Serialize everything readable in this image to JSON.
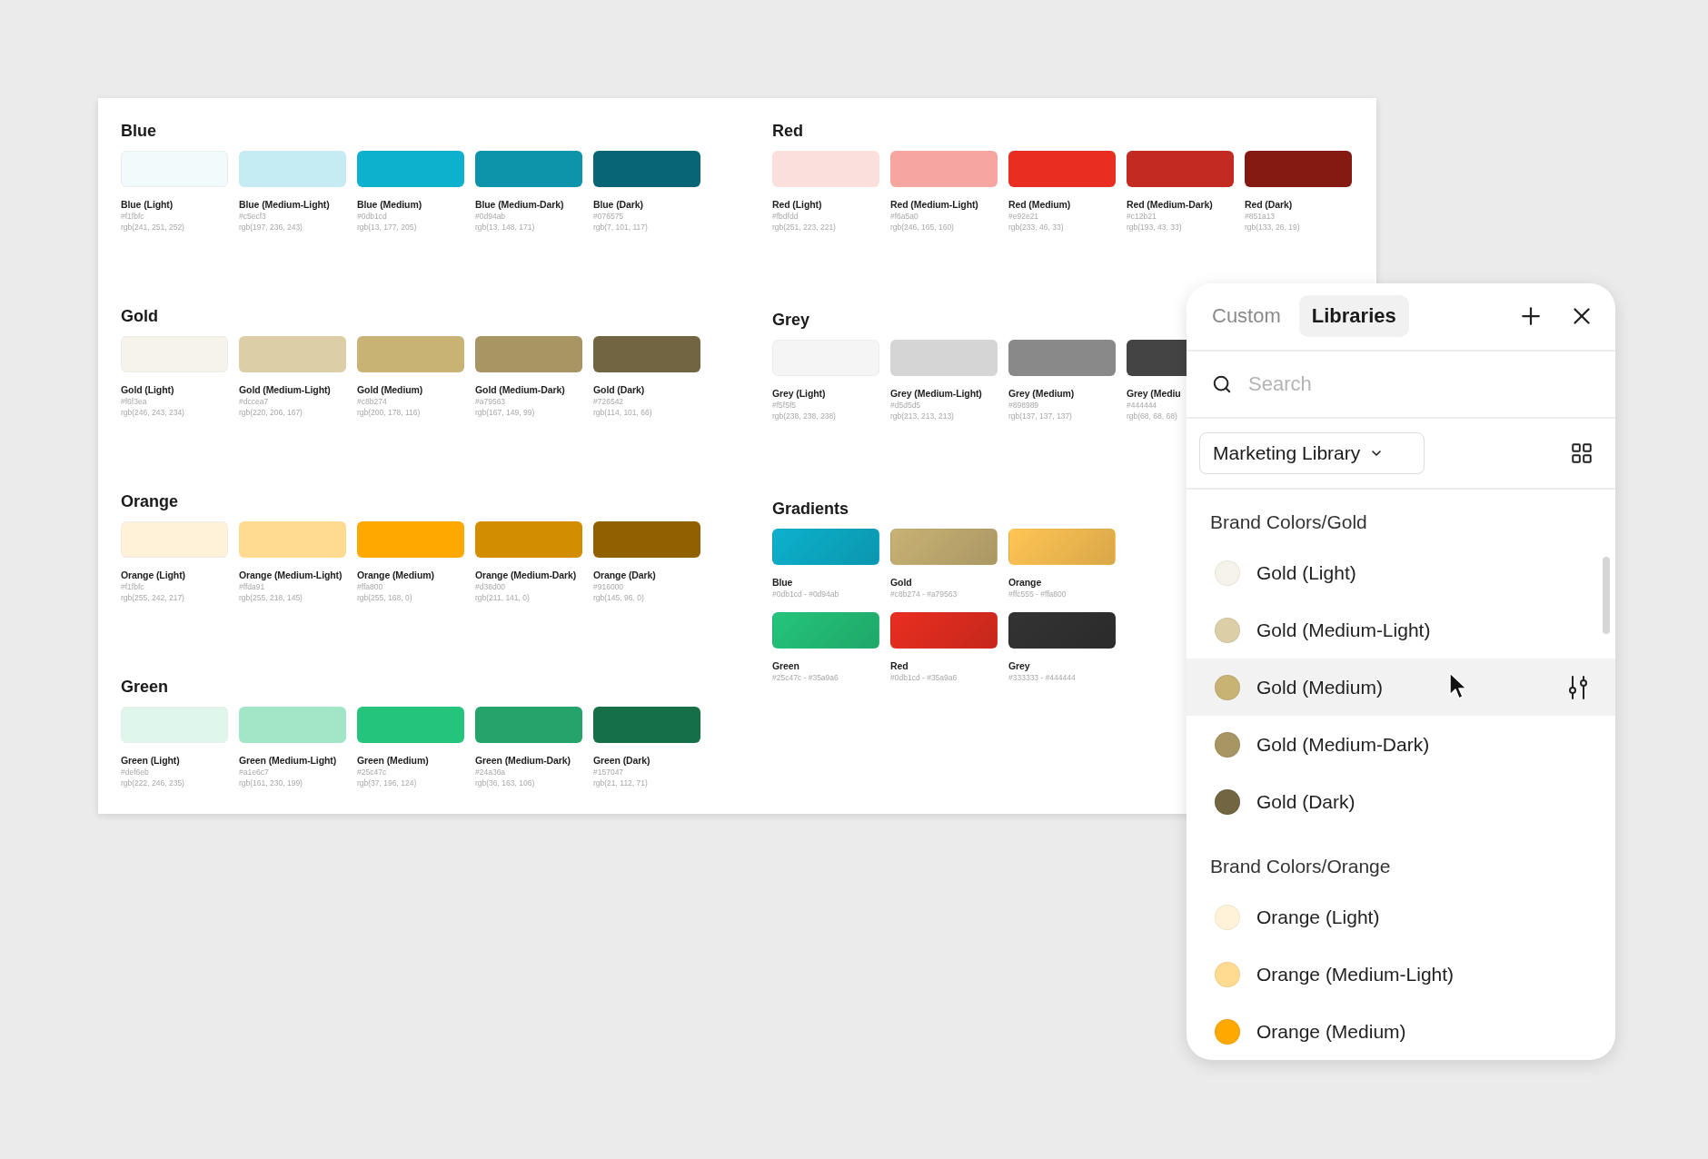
{
  "sheet": {
    "columns": [
      {
        "sections": [
          {
            "title": "Blue",
            "kind": "solid",
            "swatches": [
              {
                "name": "Blue (Light)",
                "hex": "#f1fbfc",
                "rgb": "rgb(241, 251, 252)",
                "color": "#f1fbfc"
              },
              {
                "name": "Blue (Medium-Light)",
                "hex": "#c5ecf3",
                "rgb": "rgb(197, 236, 243)",
                "color": "#c5ecf3"
              },
              {
                "name": "Blue (Medium)",
                "hex": "#0db1cd",
                "rgb": "rgb(13, 177, 205)",
                "color": "#0db1cd"
              },
              {
                "name": "Blue (Medium-Dark)",
                "hex": "#0d94ab",
                "rgb": "rgb(13, 148, 171)",
                "color": "#0d94ab"
              },
              {
                "name": "Blue (Dark)",
                "hex": "#076575",
                "rgb": "rgb(7, 101, 117)",
                "color": "#076575"
              }
            ]
          },
          {
            "title": "Gold",
            "kind": "solid",
            "swatches": [
              {
                "name": "Gold (Light)",
                "hex": "#f6f3ea",
                "rgb": "rgb(246, 243, 234)",
                "color": "#f6f3ea"
              },
              {
                "name": "Gold (Medium-Light)",
                "hex": "#dccea7",
                "rgb": "rgb(220, 206, 167)",
                "color": "#dccea7"
              },
              {
                "name": "Gold (Medium)",
                "hex": "#c8b274",
                "rgb": "rgb(200, 178, 116)",
                "color": "#c8b274"
              },
              {
                "name": "Gold (Medium-Dark)",
                "hex": "#a79563",
                "rgb": "rgb(167, 149, 99)",
                "color": "#a79563"
              },
              {
                "name": "Gold (Dark)",
                "hex": "#726542",
                "rgb": "rgb(114, 101, 66)",
                "color": "#726542"
              }
            ]
          },
          {
            "title": "Orange",
            "kind": "solid",
            "swatches": [
              {
                "name": "Orange (Light)",
                "hex": "#f1fbfc",
                "rgb": "rgb(255, 242, 217)",
                "color": "#fff2d9"
              },
              {
                "name": "Orange (Medium-Light)",
                "hex": "#ffda91",
                "rgb": "rgb(255, 218, 145)",
                "color": "#ffda91"
              },
              {
                "name": "Orange (Medium)",
                "hex": "#ffa800",
                "rgb": "rgb(255, 168, 0)",
                "color": "#ffa800"
              },
              {
                "name": "Orange (Medium-Dark)",
                "hex": "#d38d00",
                "rgb": "rgb(211, 141, 0)",
                "color": "#d38d00"
              },
              {
                "name": "Orange (Dark)",
                "hex": "#916000",
                "rgb": "rgb(145, 96, 0)",
                "color": "#916000"
              }
            ]
          },
          {
            "title": "Green",
            "kind": "solid",
            "swatches": [
              {
                "name": "Green (Light)",
                "hex": "#def6eb",
                "rgb": "rgb(222, 246, 235)",
                "color": "#def6eb"
              },
              {
                "name": "Green (Medium-Light)",
                "hex": "#a1e6c7",
                "rgb": "rgb(161, 230, 199)",
                "color": "#a1e6c7"
              },
              {
                "name": "Green (Medium)",
                "hex": "#25c47c",
                "rgb": "rgb(37, 196, 124)",
                "color": "#25c47c"
              },
              {
                "name": "Green (Medium-Dark)",
                "hex": "#24a36a",
                "rgb": "rgb(36, 163, 106)",
                "color": "#24a36a"
              },
              {
                "name": "Green (Dark)",
                "hex": "#157047",
                "rgb": "rgb(21, 112, 71)",
                "color": "#157047"
              }
            ]
          }
        ]
      },
      {
        "sections": [
          {
            "title": "Red",
            "kind": "solid",
            "swatches": [
              {
                "name": "Red (Light)",
                "hex": "#fbdfdd",
                "rgb": "rgb(251, 223, 221)",
                "color": "#fbdfdd"
              },
              {
                "name": "Red (Medium-Light)",
                "hex": "#f6a5a0",
                "rgb": "rgb(246, 165, 160)",
                "color": "#f6a5a0"
              },
              {
                "name": "Red (Medium)",
                "hex": "#e92e21",
                "rgb": "rgb(233, 46, 33)",
                "color": "#e92e21"
              },
              {
                "name": "Red (Medium-Dark)",
                "hex": "#c12b21",
                "rgb": "rgb(193, 43, 33)",
                "color": "#c12b21"
              },
              {
                "name": "Red (Dark)",
                "hex": "#851a13",
                "rgb": "rgb(133, 26, 19)",
                "color": "#851a13"
              }
            ]
          },
          {
            "title": "Grey",
            "kind": "solid",
            "swatches": [
              {
                "name": "Grey (Light)",
                "hex": "#f5f5f5",
                "rgb": "rgb(238, 238, 238)",
                "color": "#f5f5f5"
              },
              {
                "name": "Grey (Medium-Light)",
                "hex": "#d5d5d5",
                "rgb": "rgb(213, 213, 213)",
                "color": "#d5d5d5"
              },
              {
                "name": "Grey (Medium)",
                "hex": "#898989",
                "rgb": "rgb(137, 137, 137)",
                "color": "#898989"
              },
              {
                "name": "Grey (Mediu",
                "hex": "#444444",
                "rgb": "rgb(68, 68, 68)",
                "color": "#444444"
              }
            ]
          },
          {
            "title": "Gradients",
            "kind": "gradient",
            "swatches": [
              {
                "name": "Blue",
                "range": "#0db1cd - #0d94ab",
                "color": "#0db1cd"
              },
              {
                "name": "Gold",
                "range": "#c8b274 - #a79563",
                "color": "#c8b274"
              },
              {
                "name": "Orange",
                "range": "#ffc555 - #ffa800",
                "color": "#ffc555"
              },
              {
                "name": "Green",
                "range": "#25c47c - #35a9a6",
                "color": "#25c47c"
              },
              {
                "name": "Red",
                "range": "#0db1cd - #35a9a6",
                "color": "#e92e21"
              },
              {
                "name": "Grey",
                "range": "#333333 - #444444",
                "color": "#333333"
              }
            ]
          }
        ]
      }
    ]
  },
  "panel": {
    "tabs": [
      {
        "label": "Custom",
        "selected": false
      },
      {
        "label": "Libraries",
        "selected": true
      }
    ],
    "search": {
      "placeholder": "Search"
    },
    "library": {
      "value": "Marketing Library"
    },
    "groups": [
      {
        "title": "Brand Colors/Gold",
        "items": [
          {
            "name": "Gold (Light)",
            "color": "#f6f3ea",
            "hovered": false
          },
          {
            "name": "Gold (Medium-Light)",
            "color": "#dccea7",
            "hovered": false
          },
          {
            "name": "Gold (Medium)",
            "color": "#c8b274",
            "hovered": true
          },
          {
            "name": "Gold (Medium-Dark)",
            "color": "#a79563",
            "hovered": false
          },
          {
            "name": "Gold (Dark)",
            "color": "#726542",
            "hovered": false
          }
        ]
      },
      {
        "title": "Brand Colors/Orange",
        "items": [
          {
            "name": "Orange (Light)",
            "color": "#fff2d9",
            "hovered": false
          },
          {
            "name": "Orange (Medium-Light)",
            "color": "#ffda91",
            "hovered": false
          },
          {
            "name": "Orange (Medium)",
            "color": "#ffa800",
            "hovered": false
          }
        ]
      }
    ]
  }
}
